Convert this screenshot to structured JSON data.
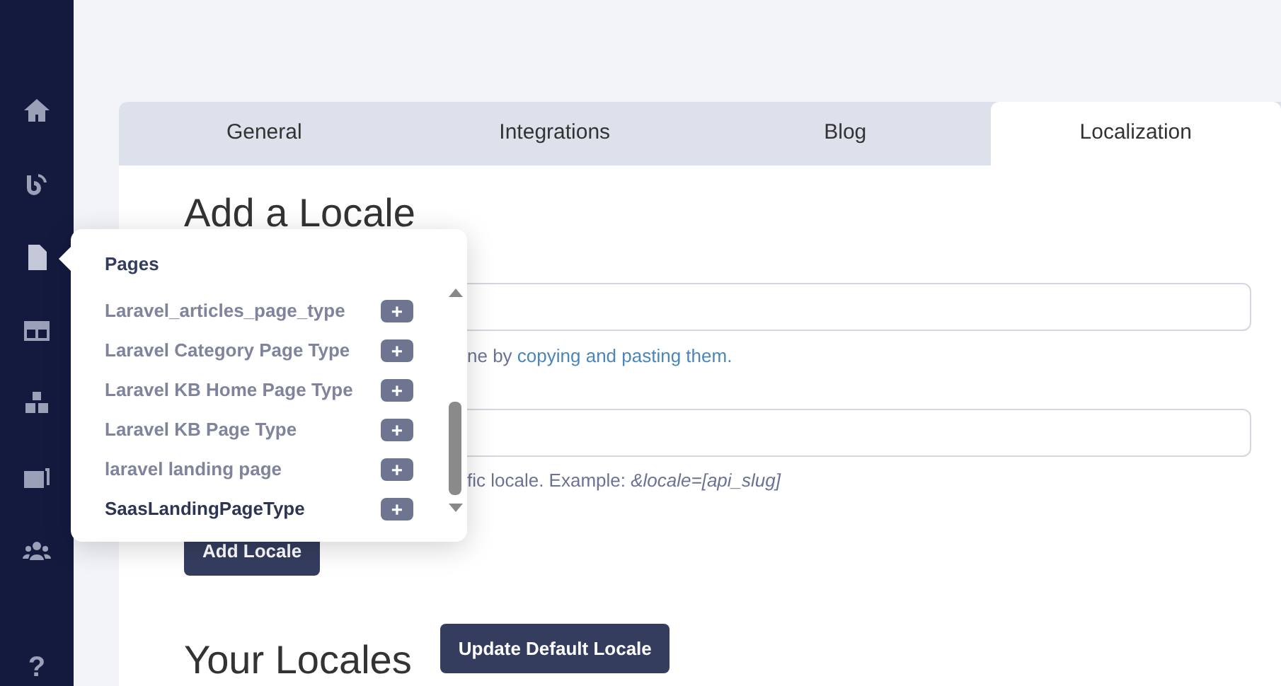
{
  "sidebar": {
    "items": [
      {
        "selected": false
      },
      {
        "selected": false
      },
      {
        "selected": true
      },
      {
        "selected": false
      },
      {
        "selected": false
      },
      {
        "selected": false
      },
      {
        "selected": false
      }
    ],
    "help": "?"
  },
  "tabs": [
    {
      "label": "General",
      "selected": false
    },
    {
      "label": "Integrations",
      "selected": false
    },
    {
      "label": "Blog",
      "selected": false
    },
    {
      "label": "Localization",
      "selected": true
    }
  ],
  "form": {
    "heading": "Add a Locale",
    "hint_1": {
      "text": "ne by ",
      "link": "copying and pasting them."
    },
    "hint_2": {
      "text": "fic locale. Example: ",
      "example": "&locale=[api_slug]"
    },
    "submit": "Add Locale"
  },
  "locales": {
    "heading": "Your Locales",
    "button": "Update Default Locale"
  },
  "popup": {
    "title": "Pages",
    "items": [
      {
        "label": "Laravel_articles_page_type",
        "add": "+",
        "current": false
      },
      {
        "label": "Laravel Category Page Type",
        "add": "+",
        "current": false
      },
      {
        "label": "Laravel KB Home Page Type",
        "add": "+",
        "current": false
      },
      {
        "label": "Laravel KB Page Type",
        "add": "+",
        "current": false
      },
      {
        "label": "laravel landing page",
        "add": "+",
        "current": false
      },
      {
        "label": "SaasLandingPageType",
        "add": "+",
        "current": true
      }
    ]
  }
}
